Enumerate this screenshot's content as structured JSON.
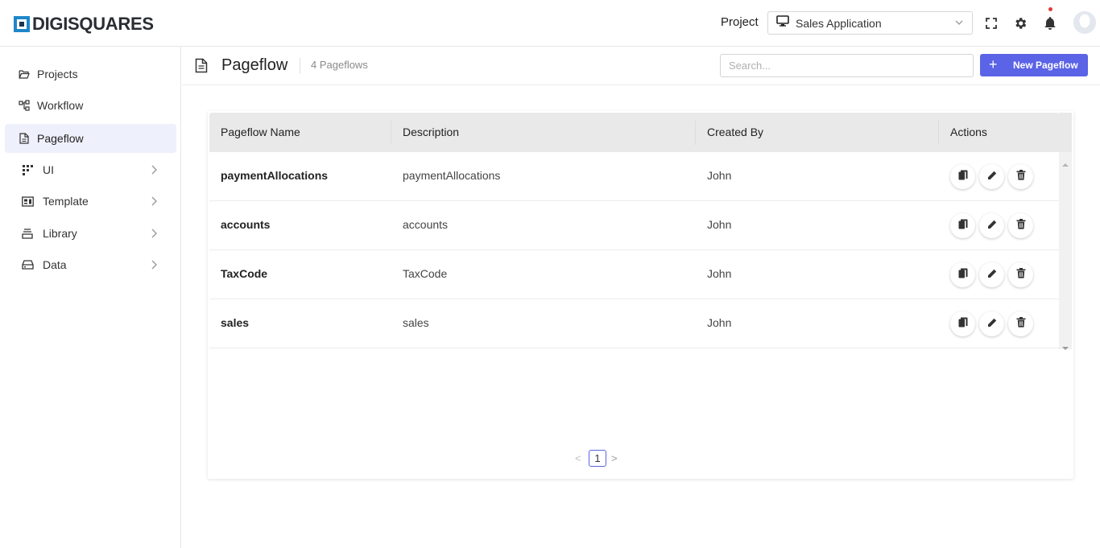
{
  "header": {
    "logo_text": "DIGISQUARES",
    "project_label": "Project",
    "project_value": "Sales Application",
    "icons": [
      "fullscreen-icon",
      "gear-icon",
      "bell-icon",
      "avatar"
    ],
    "notification_dot_color": "#e53935"
  },
  "sidebar": {
    "items": [
      {
        "label": "Projects",
        "icon": "folder-open-icon",
        "expandable": false,
        "active": false
      },
      {
        "label": "Workflow",
        "icon": "workflow-icon",
        "expandable": false,
        "active": false
      },
      {
        "label": "Pageflow",
        "icon": "document-icon",
        "expandable": false,
        "active": true
      },
      {
        "label": "UI",
        "icon": "grid-icon",
        "expandable": true,
        "active": false
      },
      {
        "label": "Template",
        "icon": "template-icon",
        "expandable": true,
        "active": false
      },
      {
        "label": "Library",
        "icon": "library-icon",
        "expandable": true,
        "active": false
      },
      {
        "label": "Data",
        "icon": "database-icon",
        "expandable": true,
        "active": false
      }
    ]
  },
  "main": {
    "title": "Pageflow",
    "count": "4 Pageflows",
    "search_placeholder": "Search...",
    "new_button": "New Pageflow",
    "new_button_plus": "+",
    "accent_color": "#5b63e6",
    "table": {
      "columns": [
        "Pageflow Name",
        "Description",
        "Created By",
        "Actions"
      ],
      "rows": [
        {
          "name": "paymentAllocations",
          "description": "paymentAllocations",
          "created_by": "John"
        },
        {
          "name": "accounts",
          "description": "accounts",
          "created_by": "John"
        },
        {
          "name": "TaxCode",
          "description": "TaxCode",
          "created_by": "John"
        },
        {
          "name": "sales",
          "description": "sales",
          "created_by": "John"
        }
      ],
      "row_actions": [
        "copy-icon",
        "pencil-icon",
        "trash-icon"
      ]
    },
    "pagination": {
      "prev": "<",
      "current": "1",
      "next": ">"
    }
  }
}
